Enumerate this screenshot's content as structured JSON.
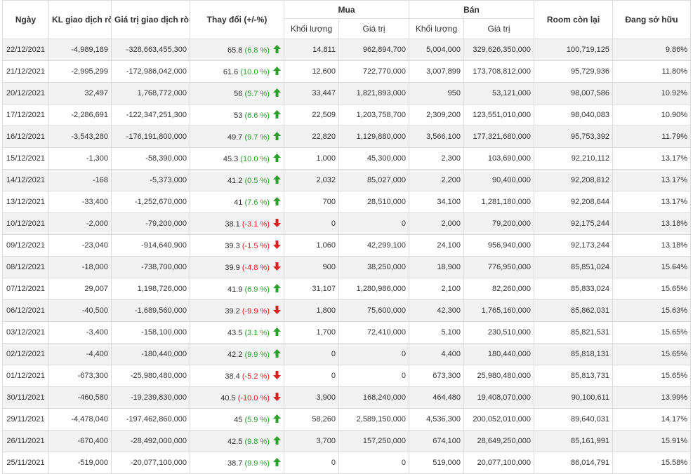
{
  "table": {
    "headers": {
      "date": "Ngày",
      "net_volume": "KL giao dịch ròng",
      "net_value": "Giá trị giao dịch ròng",
      "change": "Thay đổi (+/-%)",
      "buy_group": "Mua",
      "sell_group": "Bán",
      "buy_volume": "Khối lượng",
      "buy_value": "Giá trị",
      "sell_volume": "Khối lượng",
      "sell_value": "Giá trị",
      "room": "Room còn lại",
      "ownership": "Đang sở hữu"
    },
    "colors": {
      "up": "#2ca02c",
      "down": "#e02020",
      "row_alt": "#f2f2f2",
      "border": "#dcdcdc"
    },
    "icons": {
      "up": "arrow-up-icon",
      "down": "arrow-down-icon"
    },
    "rows": [
      {
        "date": "22/12/2021",
        "net_volume": "-4,989,189",
        "net_value": "-328,663,455,300",
        "price": "65.8",
        "pct": "(6.8 %)",
        "dir": "up",
        "buy_volume": "14,811",
        "buy_value": "962,894,700",
        "sell_volume": "5,004,000",
        "sell_value": "329,626,350,000",
        "room": "100,719,125",
        "ownership": "9.86%"
      },
      {
        "date": "21/12/2021",
        "net_volume": "-2,995,299",
        "net_value": "-172,986,042,000",
        "price": "61.6",
        "pct": "(10.0 %)",
        "dir": "up",
        "buy_volume": "12,600",
        "buy_value": "722,770,000",
        "sell_volume": "3,007,899",
        "sell_value": "173,708,812,000",
        "room": "95,729,936",
        "ownership": "11.80%"
      },
      {
        "date": "20/12/2021",
        "net_volume": "32,497",
        "net_value": "1,768,772,000",
        "price": "56",
        "pct": "(5.7 %)",
        "dir": "up",
        "buy_volume": "33,447",
        "buy_value": "1,821,893,000",
        "sell_volume": "950",
        "sell_value": "53,121,000",
        "room": "98,007,586",
        "ownership": "10.92%"
      },
      {
        "date": "17/12/2021",
        "net_volume": "-2,286,691",
        "net_value": "-122,347,251,300",
        "price": "53",
        "pct": "(6.6 %)",
        "dir": "up",
        "buy_volume": "22,509",
        "buy_value": "1,203,758,700",
        "sell_volume": "2,309,200",
        "sell_value": "123,551,010,000",
        "room": "98,040,083",
        "ownership": "10.90%"
      },
      {
        "date": "16/12/2021",
        "net_volume": "-3,543,280",
        "net_value": "-176,191,800,000",
        "price": "49.7",
        "pct": "(9.7 %)",
        "dir": "up",
        "buy_volume": "22,820",
        "buy_value": "1,129,880,000",
        "sell_volume": "3,566,100",
        "sell_value": "177,321,680,000",
        "room": "95,753,392",
        "ownership": "11.79%"
      },
      {
        "date": "15/12/2021",
        "net_volume": "-1,300",
        "net_value": "-58,390,000",
        "price": "45.3",
        "pct": "(10.0 %)",
        "dir": "up",
        "buy_volume": "1,000",
        "buy_value": "45,300,000",
        "sell_volume": "2,300",
        "sell_value": "103,690,000",
        "room": "92,210,112",
        "ownership": "13.17%"
      },
      {
        "date": "14/12/2021",
        "net_volume": "-168",
        "net_value": "-5,373,000",
        "price": "41.2",
        "pct": "(0.5 %)",
        "dir": "up",
        "buy_volume": "2,032",
        "buy_value": "85,027,000",
        "sell_volume": "2,200",
        "sell_value": "90,400,000",
        "room": "92,208,812",
        "ownership": "13.17%"
      },
      {
        "date": "13/12/2021",
        "net_volume": "-33,400",
        "net_value": "-1,252,670,000",
        "price": "41",
        "pct": "(7.6 %)",
        "dir": "up",
        "buy_volume": "700",
        "buy_value": "28,510,000",
        "sell_volume": "34,100",
        "sell_value": "1,281,180,000",
        "room": "92,208,644",
        "ownership": "13.17%"
      },
      {
        "date": "10/12/2021",
        "net_volume": "-2,000",
        "net_value": "-79,200,000",
        "price": "38.1",
        "pct": "(-3.1 %)",
        "dir": "down",
        "buy_volume": "0",
        "buy_value": "0",
        "sell_volume": "2,000",
        "sell_value": "79,200,000",
        "room": "92,175,244",
        "ownership": "13.18%"
      },
      {
        "date": "09/12/2021",
        "net_volume": "-23,040",
        "net_value": "-914,640,900",
        "price": "39.3",
        "pct": "(-1.5 %)",
        "dir": "down",
        "buy_volume": "1,060",
        "buy_value": "42,299,100",
        "sell_volume": "24,100",
        "sell_value": "956,940,000",
        "room": "92,173,244",
        "ownership": "13.18%"
      },
      {
        "date": "08/12/2021",
        "net_volume": "-18,000",
        "net_value": "-738,700,000",
        "price": "39.9",
        "pct": "(-4.8 %)",
        "dir": "down",
        "buy_volume": "900",
        "buy_value": "38,250,000",
        "sell_volume": "18,900",
        "sell_value": "776,950,000",
        "room": "85,851,024",
        "ownership": "15.64%"
      },
      {
        "date": "07/12/2021",
        "net_volume": "29,007",
        "net_value": "1,198,726,000",
        "price": "41.9",
        "pct": "(6.9 %)",
        "dir": "up",
        "buy_volume": "31,107",
        "buy_value": "1,280,986,000",
        "sell_volume": "2,100",
        "sell_value": "82,260,000",
        "room": "85,833,024",
        "ownership": "15.65%"
      },
      {
        "date": "06/12/2021",
        "net_volume": "-40,500",
        "net_value": "-1,689,560,000",
        "price": "39.2",
        "pct": "(-9.9 %)",
        "dir": "down",
        "buy_volume": "1,800",
        "buy_value": "75,600,000",
        "sell_volume": "42,300",
        "sell_value": "1,765,160,000",
        "room": "85,862,031",
        "ownership": "15.63%"
      },
      {
        "date": "03/12/2021",
        "net_volume": "-3,400",
        "net_value": "-158,100,000",
        "price": "43.5",
        "pct": "(3.1 %)",
        "dir": "up",
        "buy_volume": "1,700",
        "buy_value": "72,410,000",
        "sell_volume": "5,100",
        "sell_value": "230,510,000",
        "room": "85,821,531",
        "ownership": "15.65%"
      },
      {
        "date": "02/12/2021",
        "net_volume": "-4,400",
        "net_value": "-180,440,000",
        "price": "42.2",
        "pct": "(9.9 %)",
        "dir": "up",
        "buy_volume": "0",
        "buy_value": "0",
        "sell_volume": "4,400",
        "sell_value": "180,440,000",
        "room": "85,818,131",
        "ownership": "15.65%"
      },
      {
        "date": "01/12/2021",
        "net_volume": "-673,300",
        "net_value": "-25,980,480,000",
        "price": "38.4",
        "pct": "(-5.2 %)",
        "dir": "down",
        "buy_volume": "0",
        "buy_value": "0",
        "sell_volume": "673,300",
        "sell_value": "25,980,480,000",
        "room": "85,813,731",
        "ownership": "15.65%"
      },
      {
        "date": "30/11/2021",
        "net_volume": "-460,580",
        "net_value": "-19,239,830,000",
        "price": "40.5",
        "pct": "(-10.0 %)",
        "dir": "down",
        "buy_volume": "3,900",
        "buy_value": "168,240,000",
        "sell_volume": "464,480",
        "sell_value": "19,408,070,000",
        "room": "90,100,611",
        "ownership": "13.99%"
      },
      {
        "date": "29/11/2021",
        "net_volume": "-4,478,040",
        "net_value": "-197,462,860,000",
        "price": "45",
        "pct": "(5.9 %)",
        "dir": "up",
        "buy_volume": "58,260",
        "buy_value": "2,589,150,000",
        "sell_volume": "4,536,300",
        "sell_value": "200,052,010,000",
        "room": "89,640,031",
        "ownership": "14.17%"
      },
      {
        "date": "26/11/2021",
        "net_volume": "-670,400",
        "net_value": "-28,492,000,000",
        "price": "42.5",
        "pct": "(9.8 %)",
        "dir": "up",
        "buy_volume": "3,700",
        "buy_value": "157,250,000",
        "sell_volume": "674,100",
        "sell_value": "28,649,250,000",
        "room": "85,161,991",
        "ownership": "15.91%"
      },
      {
        "date": "25/11/2021",
        "net_volume": "-519,000",
        "net_value": "-20,077,100,000",
        "price": "38.7",
        "pct": "(9.9 %)",
        "dir": "up",
        "buy_volume": "0",
        "buy_value": "0",
        "sell_volume": "519,000",
        "sell_value": "20,077,100,000",
        "room": "86,014,791",
        "ownership": "15.58%"
      }
    ]
  }
}
